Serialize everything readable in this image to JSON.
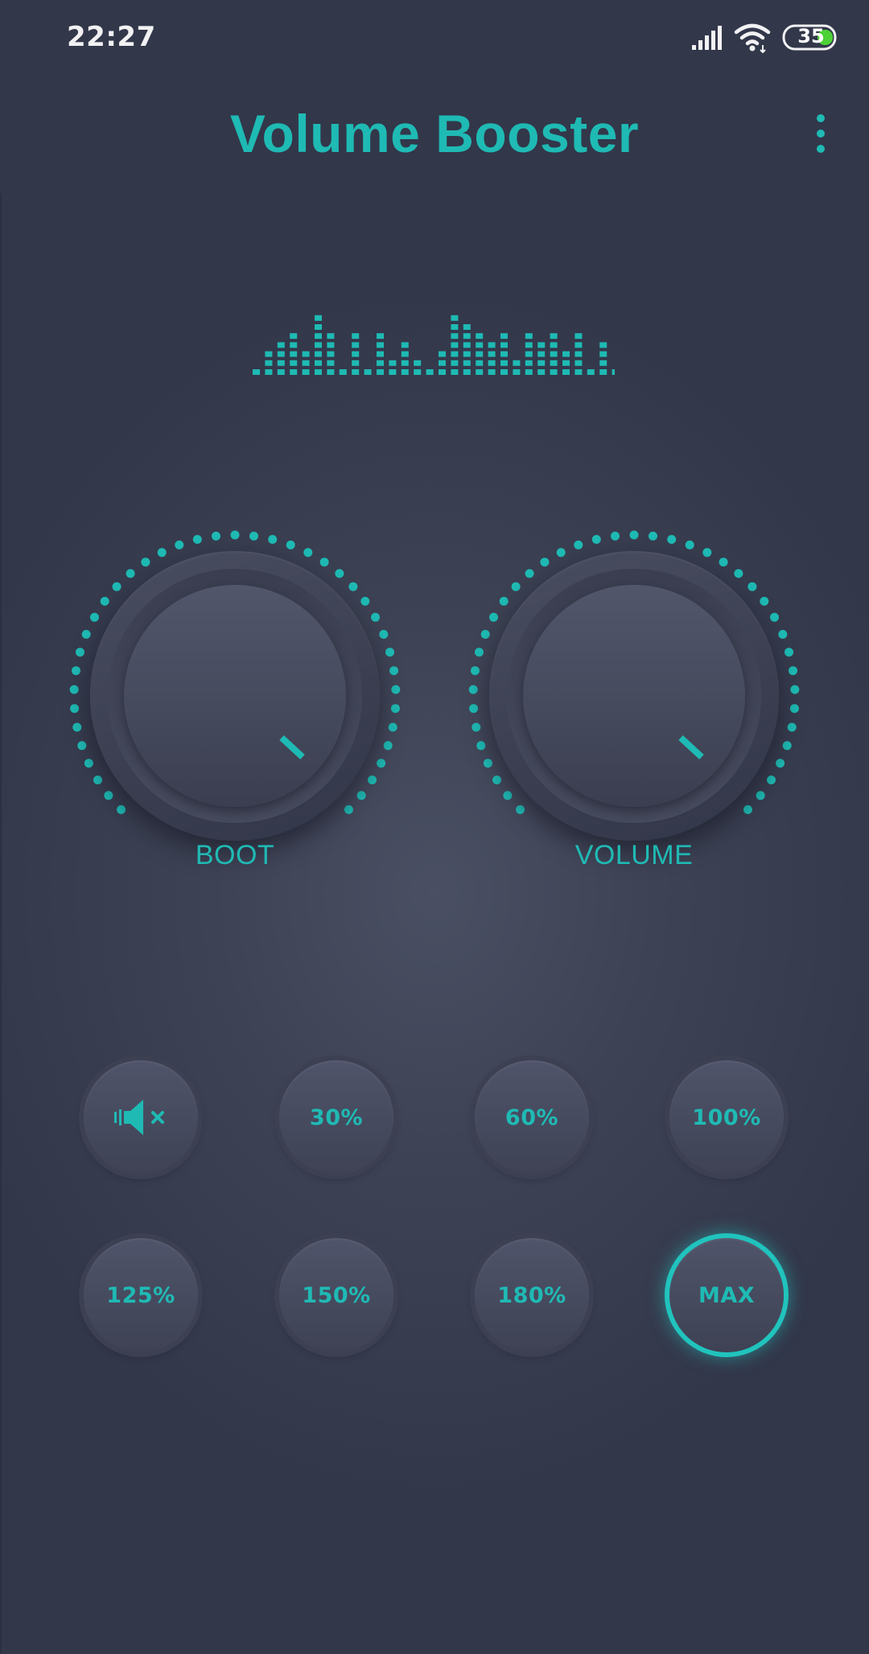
{
  "status_bar": {
    "time": "22:27",
    "battery_level": "35",
    "icons": [
      "signal-icon",
      "wifi-icon",
      "battery-icon"
    ]
  },
  "header": {
    "title": "Volume Booster",
    "menu_icon": "more-vertical-icon"
  },
  "equalizer": {
    "icon": "equalizer-bars-icon",
    "bar_levels": [
      1,
      3,
      4,
      5,
      3,
      7,
      5,
      1,
      5,
      1,
      5,
      2,
      4,
      2,
      1,
      3,
      7,
      6,
      5,
      4,
      5,
      2,
      5,
      4,
      5,
      3,
      5,
      1,
      4,
      1
    ]
  },
  "knobs": [
    {
      "label": "BOOT",
      "icon": "boost-knob"
    },
    {
      "label": "VOLUME",
      "icon": "volume-knob"
    }
  ],
  "presets": [
    {
      "label": "",
      "icon": "mute-icon"
    },
    {
      "label": "30%"
    },
    {
      "label": "60%"
    },
    {
      "label": "100%"
    },
    {
      "label": "125%"
    },
    {
      "label": "150%"
    },
    {
      "label": "180%"
    },
    {
      "label": "MAX",
      "selected": true
    }
  ],
  "colors": {
    "accent": "#1fbab4",
    "background": "#3d4254",
    "battery_fill": "#4cd137"
  }
}
